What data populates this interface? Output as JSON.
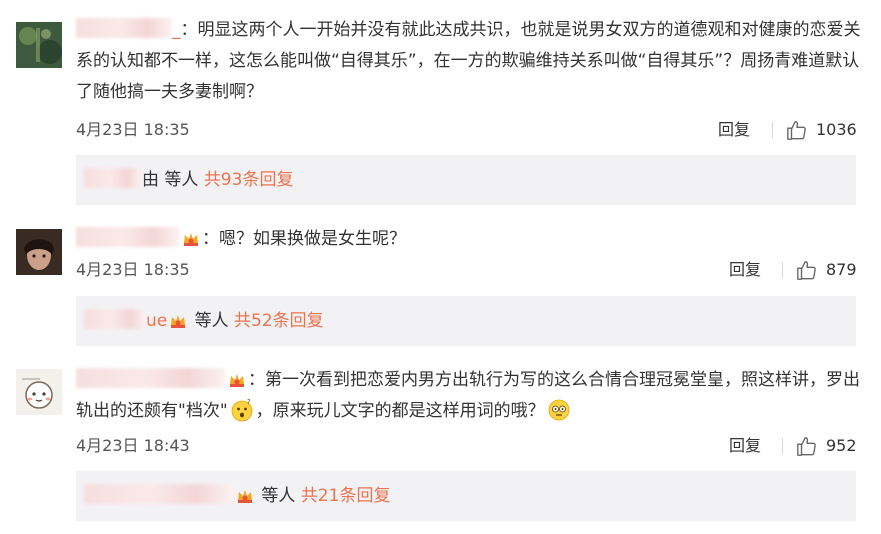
{
  "comments": [
    {
      "name_tail": "_",
      "text": "：明显这两个人一开始并没有就此达成共识，也就是说男女双方的道德观和对健康的恋爱关系的认知都不一样，这怎么能叫做“自得其乐”，在一方的欺骗维持关系叫做“自得其乐”？周扬青难道默认了随他搞一夫多妻制啊？",
      "time": "4月23日 18:35",
      "reply_label": "回复",
      "likes": "1036",
      "replies": {
        "name_tail": "由",
        "others": "等人",
        "count_text": "共93条回复"
      }
    },
    {
      "name_tail": "",
      "text": "：嗯？如果换做是女生呢？",
      "time": "4月23日 18:35",
      "reply_label": "回复",
      "likes": "879",
      "replies": {
        "name_tail": "ue",
        "others": "等人",
        "count_text": "共52条回复"
      }
    },
    {
      "name_tail": "",
      "text_a": "：第一次看到把恋爱内男方出轨行为写的这么合情合理冠冕堂皇，照这样讲，罗出轨出的还颇有\"档次\"",
      "text_b": "，原来玩儿文字的都是这样用词的哦？",
      "time": "4月23日 18:43",
      "reply_label": "回复",
      "likes": "952",
      "replies": {
        "name_tail": "",
        "others": "等人",
        "count_text": "共21条回复"
      }
    }
  ],
  "icons": {
    "like": "thumbs-up-icon",
    "badge": "crown-badge-icon",
    "emoji_wow": "surprised-emoji-icon",
    "emoji_eyes": "dizzy-eyes-emoji-icon"
  },
  "colors": {
    "accent": "#eb7350",
    "reply_bg": "#f2f2f5"
  }
}
